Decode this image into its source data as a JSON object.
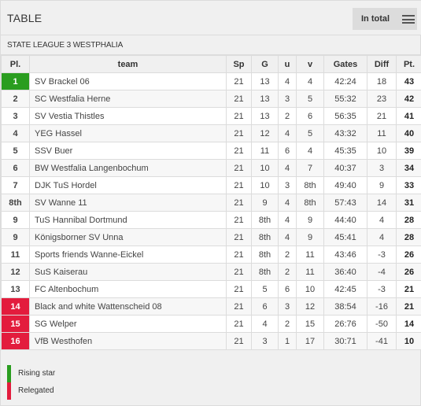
{
  "header": {
    "title": "TABLE",
    "filter_label": "In total",
    "menu_icon": "hamburger-menu-icon"
  },
  "league": {
    "name": "STATE LEAGUE 3 WESTPHALIA"
  },
  "colors": {
    "promotion": "#2a9d1f",
    "relegation": "#e31c3d"
  },
  "table": {
    "columns": [
      "Pl.",
      "team",
      "Sp",
      "G",
      "u",
      "v",
      "Gates",
      "Diff",
      "Pt."
    ],
    "rows": [
      {
        "pos": "1",
        "team": "SV Brackel 06",
        "sp": "21",
        "g": "13",
        "u": "4",
        "v": "4",
        "gates": "42:24",
        "diff": "18",
        "pts": "43",
        "status": "promo"
      },
      {
        "pos": "2",
        "team": "SC Westfalia Herne",
        "sp": "21",
        "g": "13",
        "u": "3",
        "v": "5",
        "gates": "55:32",
        "diff": "23",
        "pts": "42",
        "status": ""
      },
      {
        "pos": "3",
        "team": "SV Vestia Thistles",
        "sp": "21",
        "g": "13",
        "u": "2",
        "v": "6",
        "gates": "56:35",
        "diff": "21",
        "pts": "41",
        "status": ""
      },
      {
        "pos": "4",
        "team": "YEG Hassel",
        "sp": "21",
        "g": "12",
        "u": "4",
        "v": "5",
        "gates": "43:32",
        "diff": "11",
        "pts": "40",
        "status": ""
      },
      {
        "pos": "5",
        "team": "SSV Buer",
        "sp": "21",
        "g": "11",
        "u": "6",
        "v": "4",
        "gates": "45:35",
        "diff": "10",
        "pts": "39",
        "status": ""
      },
      {
        "pos": "6",
        "team": "BW Westfalia Langenbochum",
        "sp": "21",
        "g": "10",
        "u": "4",
        "v": "7",
        "gates": "40:37",
        "diff": "3",
        "pts": "34",
        "status": ""
      },
      {
        "pos": "7",
        "team": "DJK TuS Hordel",
        "sp": "21",
        "g": "10",
        "u": "3",
        "v": "8th",
        "gates": "49:40",
        "diff": "9",
        "pts": "33",
        "status": ""
      },
      {
        "pos": "8th",
        "team": "SV Wanne 11",
        "sp": "21",
        "g": "9",
        "u": "4",
        "v": "8th",
        "gates": "57:43",
        "diff": "14",
        "pts": "31",
        "status": ""
      },
      {
        "pos": "9",
        "team": "TuS Hannibal Dortmund",
        "sp": "21",
        "g": "8th",
        "u": "4",
        "v": "9",
        "gates": "44:40",
        "diff": "4",
        "pts": "28",
        "status": ""
      },
      {
        "pos": "9",
        "team": "Königsborner SV Unna",
        "sp": "21",
        "g": "8th",
        "u": "4",
        "v": "9",
        "gates": "45:41",
        "diff": "4",
        "pts": "28",
        "status": ""
      },
      {
        "pos": "11",
        "team": "Sports friends Wanne-Eickel",
        "sp": "21",
        "g": "8th",
        "u": "2",
        "v": "11",
        "gates": "43:46",
        "diff": "-3",
        "pts": "26",
        "status": ""
      },
      {
        "pos": "12",
        "team": "SuS Kaiserau",
        "sp": "21",
        "g": "8th",
        "u": "2",
        "v": "11",
        "gates": "36:40",
        "diff": "-4",
        "pts": "26",
        "status": ""
      },
      {
        "pos": "13",
        "team": "FC Altenbochum",
        "sp": "21",
        "g": "5",
        "u": "6",
        "v": "10",
        "gates": "42:45",
        "diff": "-3",
        "pts": "21",
        "status": ""
      },
      {
        "pos": "14",
        "team": "Black and white Wattenscheid 08",
        "sp": "21",
        "g": "6",
        "u": "3",
        "v": "12",
        "gates": "38:54",
        "diff": "-16",
        "pts": "21",
        "status": "releg"
      },
      {
        "pos": "15",
        "team": "SG Welper",
        "sp": "21",
        "g": "4",
        "u": "2",
        "v": "15",
        "gates": "26:76",
        "diff": "-50",
        "pts": "14",
        "status": "releg"
      },
      {
        "pos": "16",
        "team": "VfB Westhofen",
        "sp": "21",
        "g": "3",
        "u": "1",
        "v": "17",
        "gates": "30:71",
        "diff": "-41",
        "pts": "10",
        "status": "releg"
      }
    ]
  },
  "legend": [
    {
      "label": "Rising star",
      "status": "promo"
    },
    {
      "label": "Relegated",
      "status": "releg"
    }
  ]
}
